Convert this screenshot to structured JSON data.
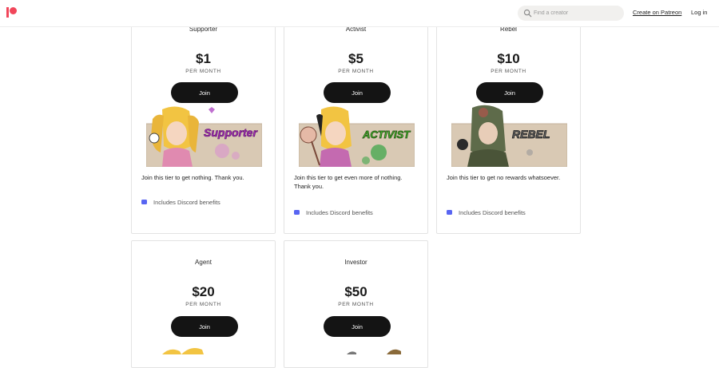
{
  "header": {
    "search_placeholder": "Find a creator",
    "create_label": "Create on Patreon",
    "login_label": "Log in",
    "brand_color": "#f1465a"
  },
  "tiers": [
    {
      "name": "Supporter",
      "price": "$1",
      "period": "PER MONTH",
      "join_label": "Join",
      "banner_text": "Supporter",
      "banner_color": "#a030b0",
      "description": "Join this tier to get nothing. Thank you.",
      "benefit": "Includes Discord benefits"
    },
    {
      "name": "Activist",
      "price": "$5",
      "period": "PER MONTH",
      "join_label": "Join",
      "banner_text": "ACTIVIST",
      "banner_color": "#4ab82f",
      "description": "Join this tier to get even more of nothing. Thank you.",
      "benefit": "Includes Discord benefits"
    },
    {
      "name": "Rebel",
      "price": "$10",
      "period": "PER MONTH",
      "join_label": "Join",
      "banner_text": "REBEL",
      "banner_color": "#6a6a6a",
      "description": "Join this tier to get no rewards whatsoever.",
      "benefit": "Includes Discord benefits"
    },
    {
      "name": "Agent",
      "price": "$20",
      "period": "PER MONTH",
      "join_label": "Join"
    },
    {
      "name": "Investor",
      "price": "$50",
      "period": "PER MONTH",
      "join_label": "Join"
    }
  ]
}
